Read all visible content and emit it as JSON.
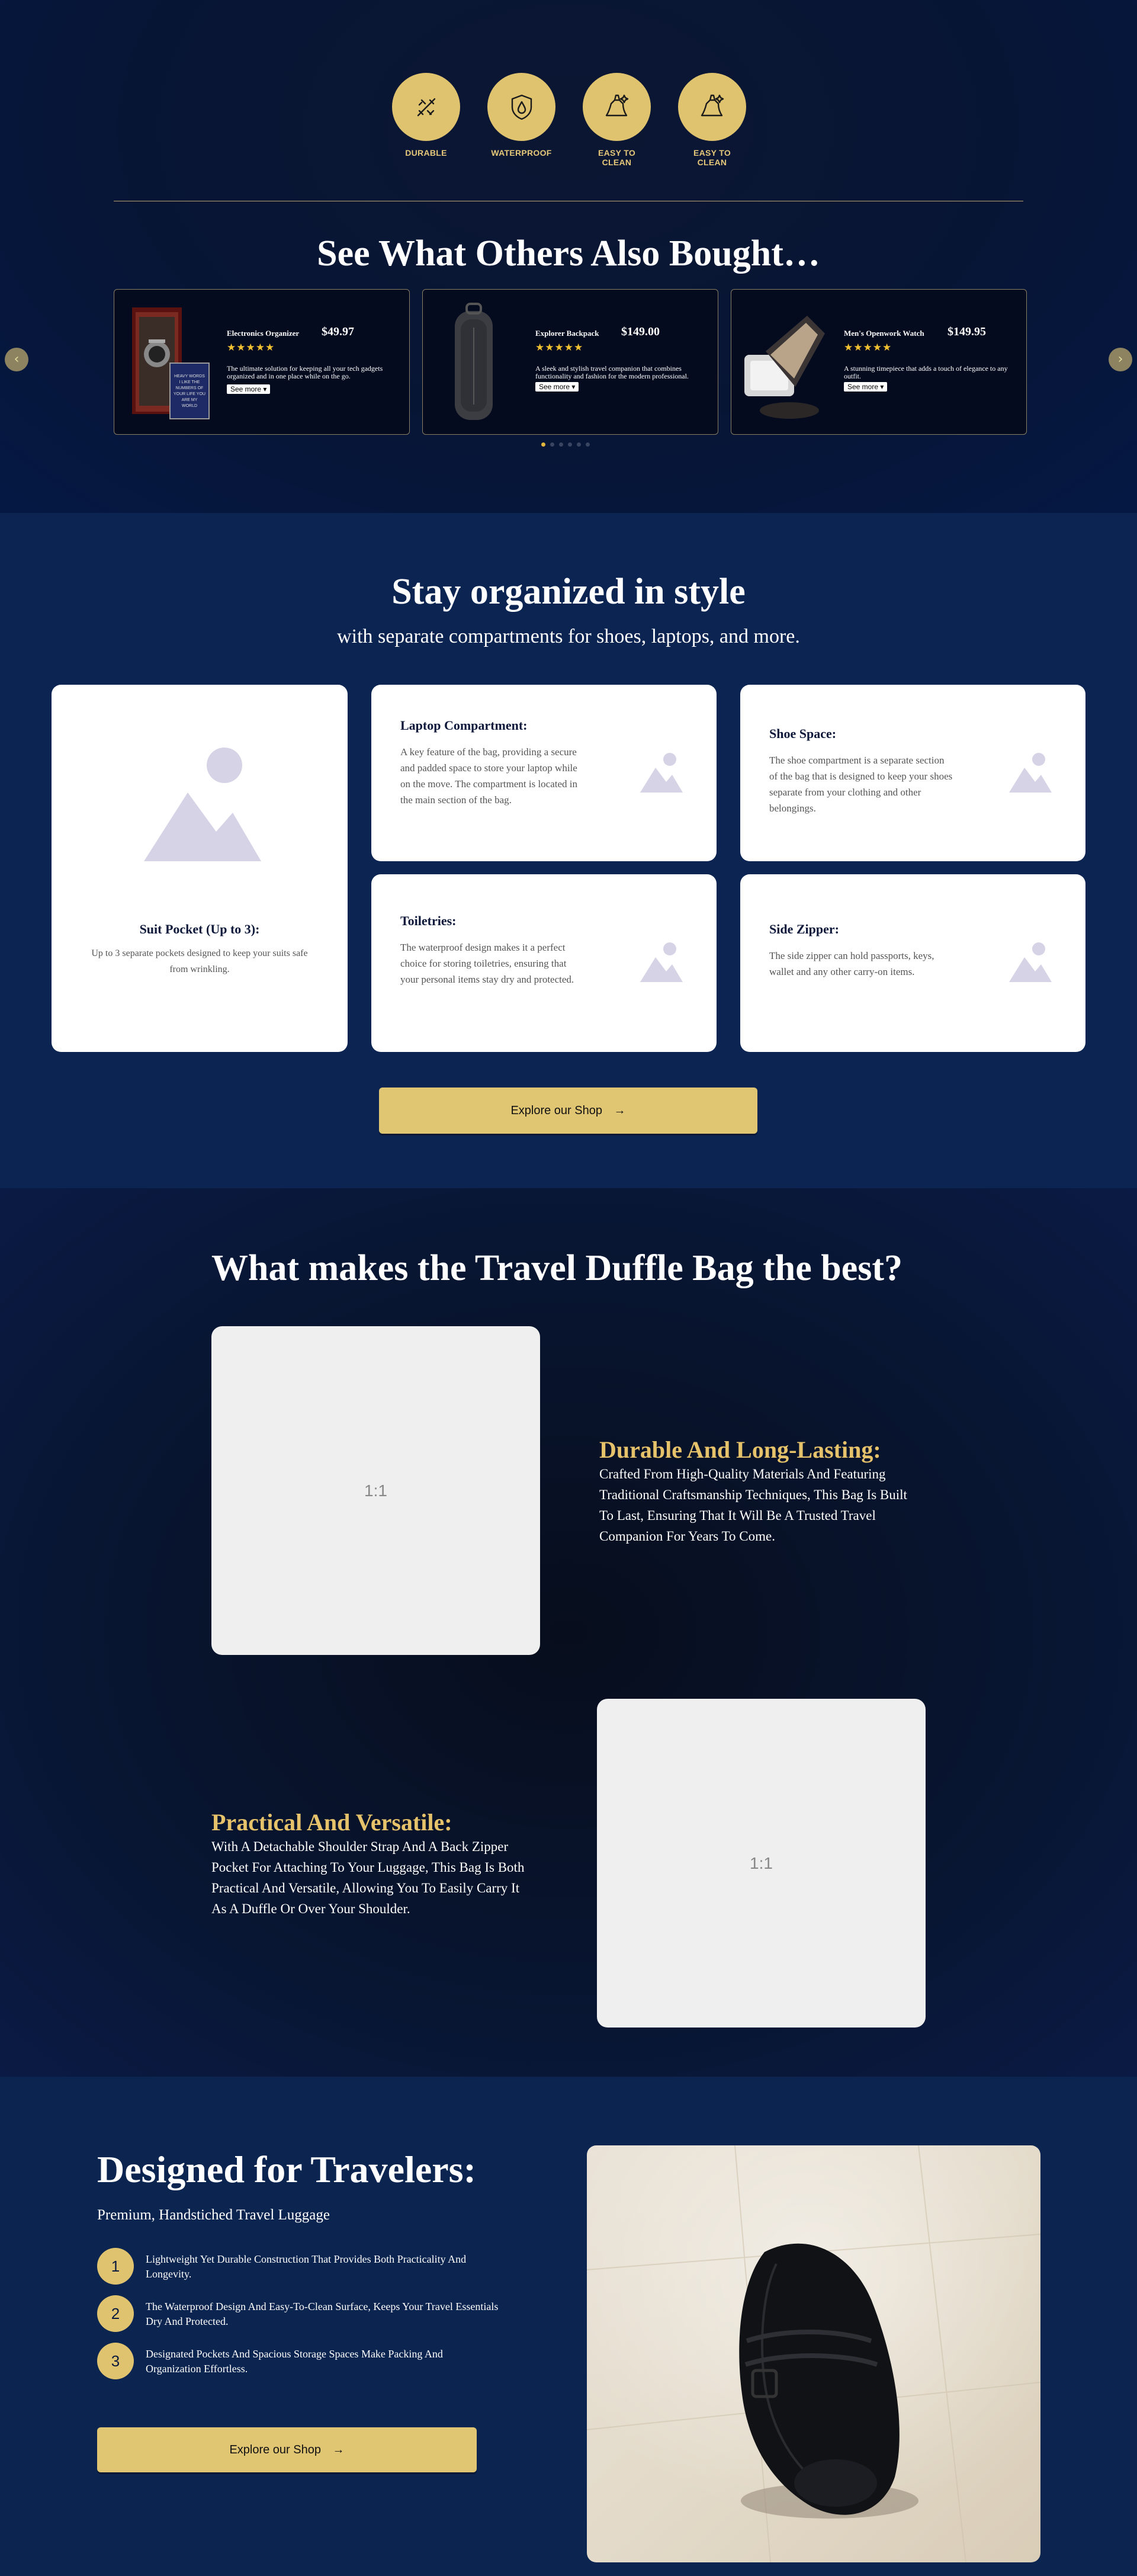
{
  "features": [
    {
      "label": "DURABLE",
      "icon": "durable-icon"
    },
    {
      "label": "WATERPROOF",
      "icon": "waterproof-icon"
    },
    {
      "label": "EASY TO CLEAN",
      "icon": "easy-clean-icon"
    },
    {
      "label": "EASY TO CLEAN",
      "icon": "easy-clean-icon"
    }
  ],
  "also_bought": {
    "title": "See What Others Also Bought…",
    "products": [
      {
        "title": "Electronics Organizer",
        "price": "$49.97",
        "stars": "★★★★★",
        "desc": "The ultimate solution for keeping all your tech gadgets organized and in one place while on the go.",
        "more": "See more",
        "img_text": "HEAVY WORDS I LIKE THE NUMBERS OF YOUR LIFE YOU ARE MY WORLD"
      },
      {
        "title": "Explorer Backpack",
        "price": "$149.00",
        "stars": "★★★★★",
        "desc": "A sleek and stylish travel companion that combines functionality and fashion for the modern professional.",
        "more": "See more"
      },
      {
        "title": "Men's Openwork Watch",
        "price": "$149.95",
        "stars": "★★★★★",
        "desc": "A stunning timepiece that adds a touch of elegance to any outfit.",
        "more": "See more"
      }
    ],
    "prev_icon": "‹",
    "next_icon": "›"
  },
  "organized": {
    "title": "Stay organized in style",
    "subtitle": "with separate compartments for shoes, laptops, and more.",
    "cards": [
      {
        "title": "Suit Pocket (Up to 3):",
        "text": "Up to 3 separate pockets designed to keep your suits safe from wrinkling."
      },
      {
        "title": "Laptop Compartment:",
        "text": "A key feature of the bag, providing a secure and padded space to store your laptop while on the move. The compartment is located in the main section of the bag."
      },
      {
        "title": "Shoe Space:",
        "text": "The shoe compartment is a separate section of the bag that is designed to keep your shoes separate from your clothing and other belongings."
      },
      {
        "title": "Toiletries:",
        "text": "The waterproof design makes it a perfect choice for storing toiletries, ensuring that your personal items stay dry and protected."
      },
      {
        "title": "Side Zipper:",
        "text": "The side zipper can hold passports, keys, wallet and any other carry-on items."
      }
    ],
    "button": "Explore our Shop",
    "button_icon": "→"
  },
  "best": {
    "title": "What makes the Travel Duffle Bag the best?",
    "ratio": "1:1",
    "items": [
      {
        "title": "Durable And Long-Lasting:",
        "text": "Crafted From High-Quality Materials And Featuring Traditional Craftsmanship Techniques, This Bag Is Built To Last, Ensuring That It Will Be A Trusted Travel Companion For Years To Come."
      },
      {
        "title": "Practical And Versatile:",
        "text": "With A Detachable Shoulder Strap And A Back Zipper Pocket For Attaching To Your Luggage, This Bag Is Both Practical And Versatile, Allowing You To Easily Carry It As A Duffle Or Over Your Shoulder."
      }
    ]
  },
  "designed": {
    "title": "Designed for Travelers:",
    "subtitle": "Premium, Handstiched Travel Luggage",
    "points": [
      {
        "num": "1",
        "text": "Lightweight Yet Durable Construction That Provides Both Practicality And Longevity."
      },
      {
        "num": "2",
        "text": "The Waterproof Design And Easy-To-Clean Surface, Keeps Your Travel Essentials Dry And Protected."
      },
      {
        "num": "3",
        "text": "Designated Pockets And Spacious Storage Spaces Make Packing And Organization Effortless."
      }
    ],
    "button": "Explore our Shop",
    "button_icon": "→"
  },
  "colors": {
    "gold": "#e0c36f",
    "navy": "#0b2452",
    "star": "#f2c230"
  }
}
